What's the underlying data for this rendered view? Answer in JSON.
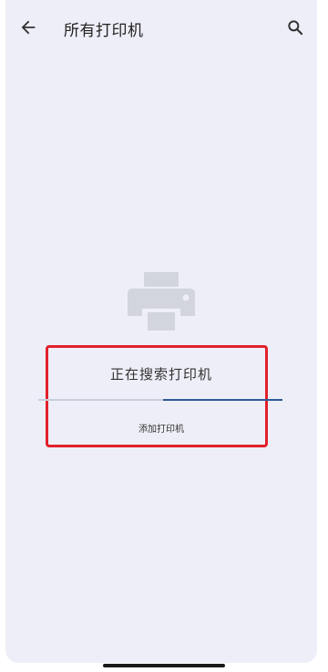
{
  "appbar": {
    "back_icon": "arrow-left-icon",
    "title": "所有打印机",
    "search_icon": "search-icon"
  },
  "empty_state": {
    "illustration_icon": "printer-icon",
    "status_text": "正在搜索打印机",
    "progress_fraction": 0.49,
    "add_printer_label": "添加打印机"
  },
  "colors": {
    "background": "#eeeef8",
    "progress_fill": "#2d5a96",
    "progress_track": "#c9cfdc",
    "highlight_border": "#e2202c"
  }
}
